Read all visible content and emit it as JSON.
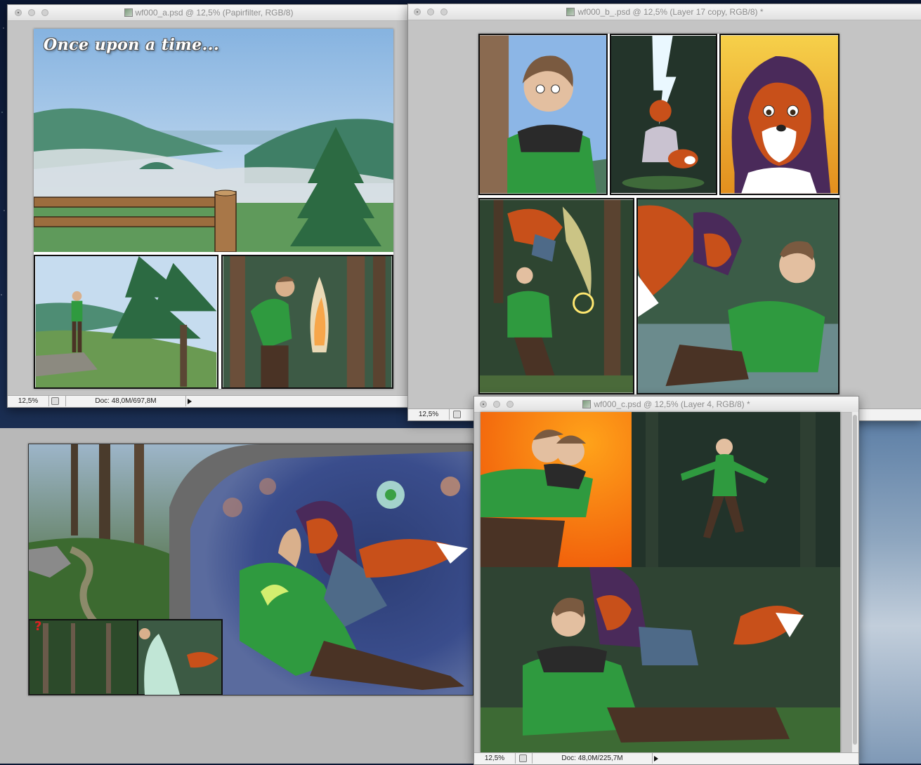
{
  "windows": {
    "a": {
      "title": "wf000_a.psd @ 12,5% (Papirfilter, RGB/8)",
      "zoom": "12,5%",
      "doc": "Doc: 48,0M/697,8M"
    },
    "b": {
      "title": "wf000_b_.psd @ 12,5% (Layer 17 copy, RGB/8) *",
      "zoom": "12,5%"
    },
    "c": {
      "title": "wf000_c.psd @ 12,5% (Layer 4, RGB/8) *",
      "zoom": "12,5%",
      "doc": "Doc: 48,0M/225,7M"
    }
  },
  "comic": {
    "caption": "Once upon a time..."
  },
  "icons": [
    "close-button",
    "minimize-button",
    "zoom-button",
    "document-icon",
    "status-info-icon",
    "status-menu-arrow"
  ],
  "colors": {
    "titlebar": "#e8e8e8",
    "canvas": "#c4c4c4",
    "jacket_green": "#2f9a3f",
    "fox_orange": "#c8501a",
    "hair_purple": "#4a2a5a"
  }
}
